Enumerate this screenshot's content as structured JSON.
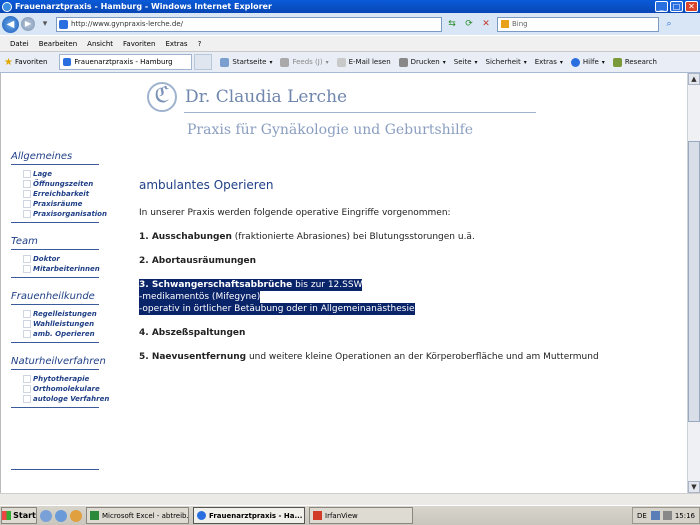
{
  "window": {
    "title": "Frauenarztpraxis - Hamburg - Windows Internet Explorer",
    "controls": [
      "minimize",
      "maximize",
      "close"
    ]
  },
  "address_bar": {
    "url": "http://www.gynpraxis-lerche.de/",
    "search_placeholder": "Bing"
  },
  "menu": [
    "Datei",
    "Bearbeiten",
    "Ansicht",
    "Favoriten",
    "Extras",
    "?"
  ],
  "favorites_bar": {
    "favorites_label": "Favoriten",
    "tab_title": "Frauenarztpraxis - Hamburg"
  },
  "command_bar": {
    "startseite": "Startseite",
    "feeds": "Feeds (J)",
    "email": "E-Mail lesen",
    "drucken": "Drucken",
    "seite": "Seite",
    "sicherheit": "Sicherheit",
    "extras": "Extras",
    "hilfe": "Hilfe",
    "research": "Research"
  },
  "logo": {
    "mark": "CL",
    "name": "Dr. Claudia Lerche",
    "subtitle": "Praxis für Gynäkologie und Geburtshilfe"
  },
  "sidebar": {
    "sections": [
      {
        "title": "Allgemeines",
        "items": [
          "Lage",
          "Öffnungszeiten",
          "Erreichbarkeit",
          "Praxisräume",
          "Praxisorganisation"
        ]
      },
      {
        "title": "Team",
        "items": [
          "Doktor",
          "Mitarbeiterinnen"
        ]
      },
      {
        "title": "Frauenheilkunde",
        "items": [
          "Regelleistungen",
          "Wahlleistungen",
          "amb. Operieren"
        ]
      },
      {
        "title": "Naturheilverfahren",
        "items": [
          "Phytotherapie",
          "Orthomolekulare",
          "autologe Verfahren"
        ]
      }
    ]
  },
  "main": {
    "heading": "ambulantes Operieren",
    "intro": "In unserer Praxis werden folgende operative Eingriffe vorgenommen:",
    "item1_bold": "1. Ausschabungen",
    "item1_rest": " (fraktionierte Abrasiones) bei Blutungsstorungen u.ä.",
    "item2_bold": "2. Abortausräumungen",
    "item3_bold": "3. Schwangerschaftsabbrüche",
    "item3_rest": " bis zur 12.SSW",
    "item3_line2": "-medikamentös (Mifegyne)",
    "item3_line3": "-operativ in örtlicher Betäubung oder in Allgemeinanästhesie",
    "item4_bold": "4. Abszeßspaltungen",
    "item5_bold": "5. Naevusentfernung",
    "item5_rest": " und weitere kleine Operationen an der Körperoberfläche und am Muttermund"
  },
  "taskbar": {
    "start": "Start",
    "tasks": [
      "Microsoft Excel - abtreib...",
      "Frauenarztpraxis - Ha...",
      "IrfanView"
    ],
    "tray_lang": "DE",
    "clock": "15:16"
  }
}
